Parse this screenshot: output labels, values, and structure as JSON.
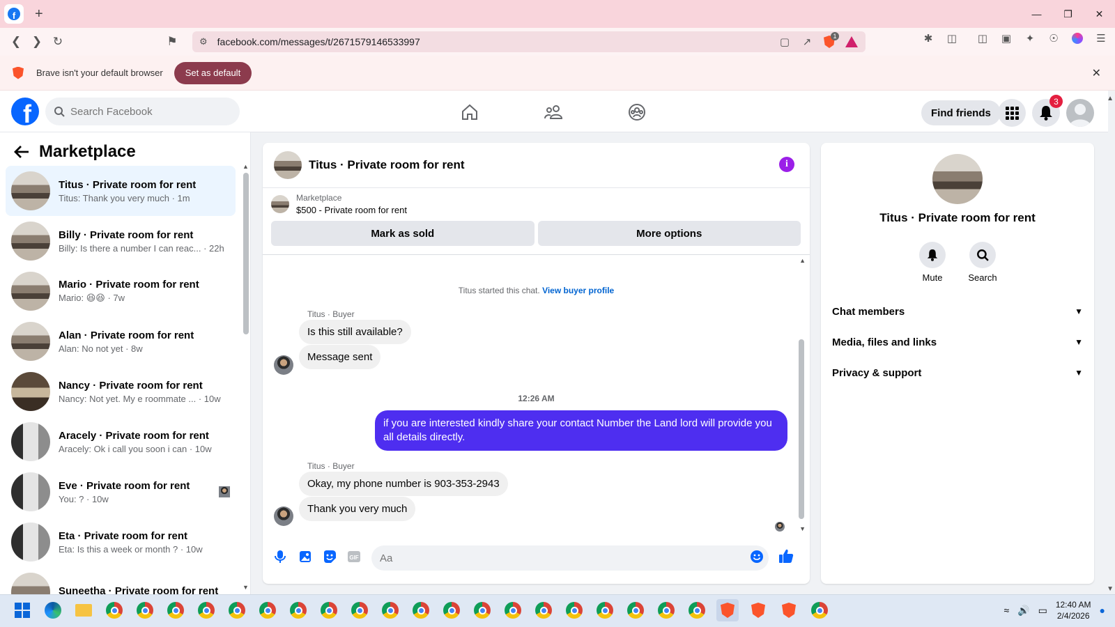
{
  "browser": {
    "url": "facebook.com/messages/t/2671579146533997",
    "brave_badge": "1",
    "infobar_text": "Brave isn't your default browser",
    "set_default_label": "Set as default"
  },
  "header": {
    "search_placeholder": "Search Facebook",
    "find_friends_label": "Find friends",
    "notification_count": "3"
  },
  "sidebar": {
    "title": "Marketplace",
    "conversations": [
      {
        "name": "Titus · Private room for rent",
        "preview": "Titus: Thank you very much · 1m",
        "active": true
      },
      {
        "name": "Billy · Private room for rent",
        "preview": "Billy: Is there a number I can reac... · 22h",
        "active": false
      },
      {
        "name": "Mario · Private room for rent",
        "preview": "Mario: 😆😆 · 7w",
        "active": false
      },
      {
        "name": "Alan · Private room for rent",
        "preview": "Alan: No not yet · 8w",
        "active": false
      },
      {
        "name": "Nancy · Private room for rent",
        "preview": "Nancy: Not yet. My e roommate ... · 10w",
        "active": false
      },
      {
        "name": "Aracely · Private room for rent",
        "preview": "Aracely: Ok i call you soon i can · 10w",
        "active": false
      },
      {
        "name": "Eve · Private room for rent",
        "preview": "You: ? · 10w",
        "active": false
      },
      {
        "name": "Eta · Private room for rent",
        "preview": "Eta: Is this a week or month ? · 10w",
        "active": false
      },
      {
        "name": "Suneetha · Private room for rent",
        "preview": "",
        "active": false
      }
    ]
  },
  "chat": {
    "title": "Titus · Private room for rent",
    "listing": {
      "label": "Marketplace",
      "price_title": "$500 - Private room for rent",
      "mark_sold_label": "Mark as sold",
      "more_options_label": "More options"
    },
    "started_text": "Titus started this chat.",
    "view_buyer_label": "View buyer profile",
    "sender_label": "Titus · Buyer",
    "messages_block1": [
      "Is this still available?",
      "Message sent"
    ],
    "timestamp": "12:26 AM",
    "outgoing": "if you are interested kindly share your contact Number the Land lord will provide you all details directly.",
    "messages_block2": [
      "Okay, my phone number is 903-353-2943",
      "Thank you very much"
    ],
    "composer_placeholder": "Aa"
  },
  "details": {
    "title": "Titus · Private room for rent",
    "mute_label": "Mute",
    "search_label": "Search",
    "sections": [
      "Chat members",
      "Media, files and links",
      "Privacy & support"
    ]
  },
  "taskbar": {
    "time": "12:40 AM",
    "date": "2/4/2026"
  },
  "colors": {
    "fb_blue": "#0866ff",
    "outgoing_bubble": "#4e2ef0",
    "info_purple": "#9b1fe8",
    "set_default_button": "#8c3b4d",
    "tab_strip": "#f9d5dc"
  }
}
